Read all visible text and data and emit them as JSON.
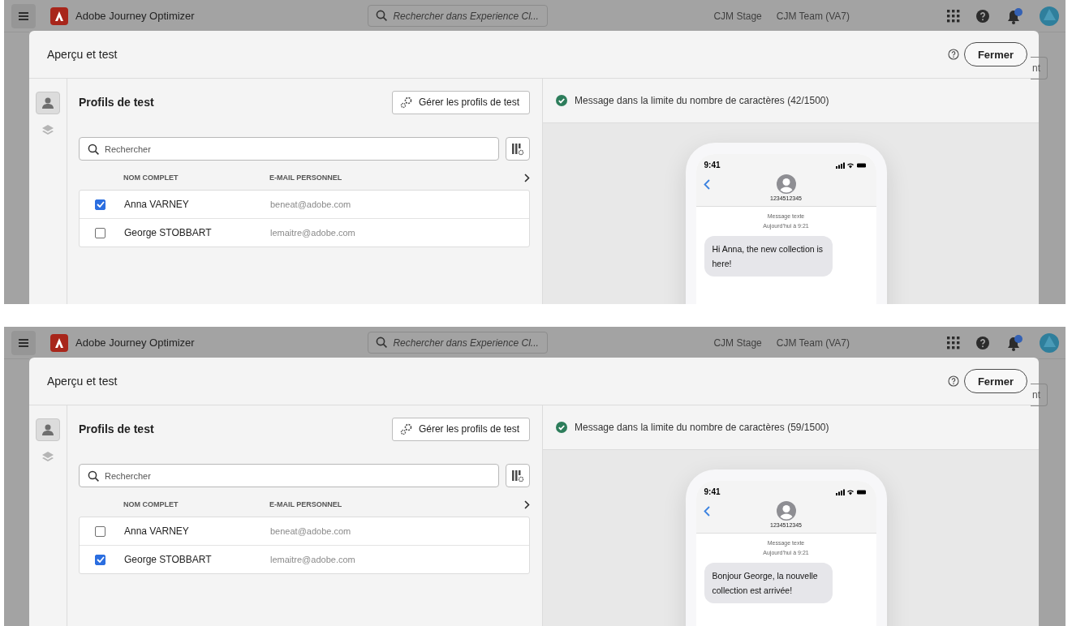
{
  "screens": [
    {
      "app_title": "Adobe Journey Optimizer",
      "search_placeholder": "Rechercher dans Experience Cl...",
      "org_items": [
        "CJM Stage",
        "CJM Team (VA7)"
      ],
      "background_button": "nt",
      "dialog": {
        "title": "Aperçu et test",
        "close_button": "Fermer",
        "rail": [
          {
            "kind": "person",
            "selected": true
          },
          {
            "kind": "layers",
            "selected": false
          }
        ],
        "panel_title": "Profils de test",
        "manage_button": "Gérer les profils de test",
        "search_placeholder": "Rechercher",
        "columns": [
          "NOM COMPLET",
          "E-MAIL PERSONNEL"
        ],
        "rows": [
          {
            "name": "Anna VARNEY",
            "email": "beneat@adobe.com",
            "checked": true
          },
          {
            "name": "George STOBBART",
            "email": "lemaitre@adobe.com",
            "checked": false
          }
        ],
        "status": {
          "kind": "success",
          "text": "Message dans la limite du nombre de caractères (42/1500)"
        },
        "phone": {
          "time": "9:41",
          "contact": "1234512345",
          "label": "Message texte",
          "timestamp": "Aujourd’hui à 9:21",
          "message": "Hi Anna, the new collection is here!"
        }
      }
    },
    {
      "app_title": "Adobe Journey Optimizer",
      "search_placeholder": "Rechercher dans Experience Cl...",
      "org_items": [
        "CJM Stage",
        "CJM Team (VA7)"
      ],
      "background_button": "nt",
      "dialog": {
        "title": "Aperçu et test",
        "close_button": "Fermer",
        "rail": [
          {
            "kind": "person",
            "selected": true
          },
          {
            "kind": "layers",
            "selected": false
          }
        ],
        "panel_title": "Profils de test",
        "manage_button": "Gérer les profils de test",
        "search_placeholder": "Rechercher",
        "columns": [
          "NOM COMPLET",
          "E-MAIL PERSONNEL"
        ],
        "rows": [
          {
            "name": "Anna VARNEY",
            "email": "beneat@adobe.com",
            "checked": false
          },
          {
            "name": "George STOBBART",
            "email": "lemaitre@adobe.com",
            "checked": true
          }
        ],
        "status": {
          "kind": "success",
          "text": "Message dans la limite du nombre de caractères (59/1500)"
        },
        "phone": {
          "time": "9:41",
          "contact": "1234512345",
          "label": "Message texte",
          "timestamp": "Aujourd’hui à 9:21",
          "message": "Bonjour George, la nouvelle collection est arrivée!"
        }
      }
    }
  ]
}
